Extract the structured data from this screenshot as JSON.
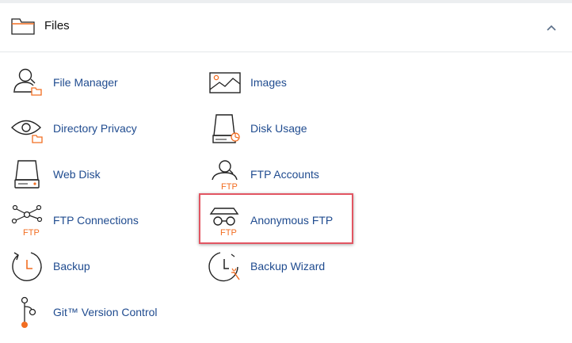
{
  "section": {
    "title": "Files",
    "icons": {
      "header": "folder-icon",
      "collapse": "chevron-up-icon"
    }
  },
  "items": [
    {
      "label": "File Manager",
      "icon": "file-manager-icon"
    },
    {
      "label": "Images",
      "icon": "images-icon"
    },
    {
      "label": "Directory Privacy",
      "icon": "directory-privacy-icon"
    },
    {
      "label": "Disk Usage",
      "icon": "disk-usage-icon"
    },
    {
      "label": "Web Disk",
      "icon": "web-disk-icon"
    },
    {
      "label": "FTP Accounts",
      "icon": "ftp-accounts-icon",
      "icon_text": "FTP"
    },
    {
      "label": "FTP Connections",
      "icon": "ftp-connections-icon",
      "icon_text": "FTP"
    },
    {
      "label": "Anonymous FTP",
      "icon": "anonymous-ftp-icon",
      "icon_text": "FTP",
      "highlighted": true
    },
    {
      "label": "Backup",
      "icon": "backup-icon"
    },
    {
      "label": "Backup Wizard",
      "icon": "backup-wizard-icon"
    },
    {
      "label": "Git™ Version Control",
      "icon": "git-version-control-icon"
    }
  ],
  "colors": {
    "link": "#1f4b8f",
    "accent": "#f26d21",
    "icon_stroke": "#222222",
    "highlight": "#e25562"
  }
}
